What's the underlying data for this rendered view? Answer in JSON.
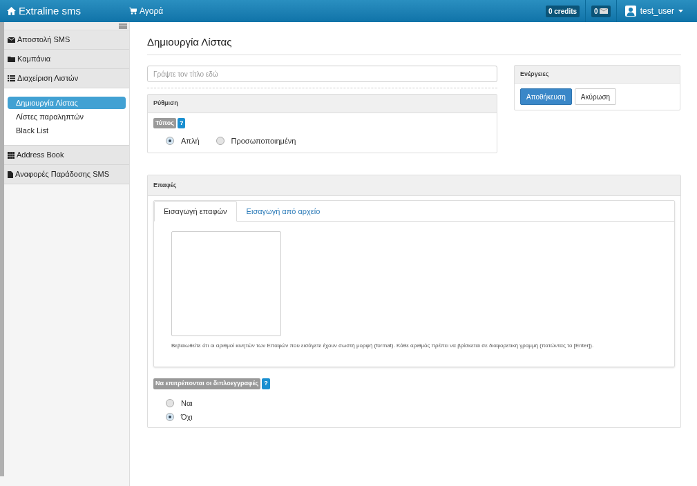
{
  "header": {
    "brand": "Extraline sms",
    "shop": "Αγορά",
    "credits": "0 credits",
    "messages": "0",
    "user": "test_user"
  },
  "sidebar": {
    "items": [
      {
        "label": "Αποστολή SMS"
      },
      {
        "label": "Καμπάνια"
      },
      {
        "label": "Διαχείριση Λιστών",
        "children": [
          {
            "label": "Δημιουργία Λίστας",
            "selected": true
          },
          {
            "label": "Λίστες παραληπτών",
            "selected": false
          },
          {
            "label": "Black List",
            "selected": false
          }
        ]
      },
      {
        "label": "Address Book"
      },
      {
        "label": "Αναφορές Παράδοσης SMS"
      }
    ]
  },
  "page": {
    "title": "Δημιουργία Λίστας",
    "title_field": {
      "placeholder": "Γράψτε τον τίτλο εδώ"
    },
    "settings": {
      "heading": "Ρύθμιση",
      "label": "Τύπος",
      "help": "?",
      "options": [
        {
          "label": "Απλή",
          "selected": true
        },
        {
          "label": "Προσωποποιημένη",
          "selected": false
        }
      ]
    },
    "actions": {
      "heading": "Ενέργειες",
      "buttons": [
        {
          "label": "Αποθήκευση",
          "kind": "primary"
        },
        {
          "label": "Ακύρωση",
          "kind": "default"
        }
      ]
    },
    "contacts": {
      "heading": "Επαφές",
      "tabs": [
        {
          "label": "Εισαγωγή επαφών",
          "selected": true
        },
        {
          "label": "Εισαγωγή από αρχείο",
          "selected": false
        }
      ],
      "hint": "Βεβαιωθείτε ότι οι αριθμοί κινητών των Επαφών που εισάγετε έχουν σωστή μορφή (format). Κάθε αριθμός πρέπει να βρίσκεται σε διαφορετική γραμμή (πατώντας το [Enter]).",
      "duplicates": {
        "label": "Να επιτρέπονται οι διπλοεγγραφές",
        "help": "?",
        "options": [
          {
            "label": "Ναι",
            "selected": false
          },
          {
            "label": "Όχι",
            "selected": true
          }
        ]
      }
    }
  }
}
